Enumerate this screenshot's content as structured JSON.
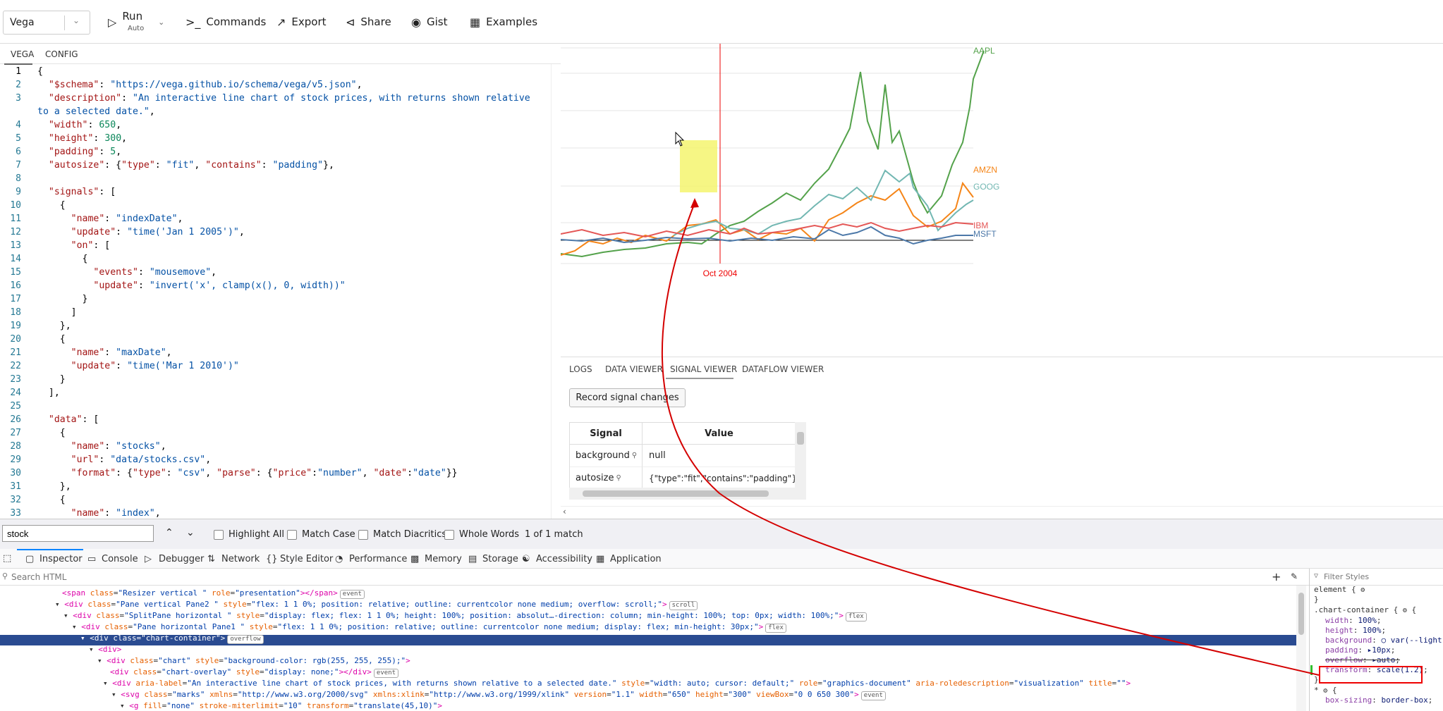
{
  "toolbar": {
    "mode": "Vega",
    "run": "Run",
    "run_sub": "Auto",
    "commands": "Commands",
    "export": "Export",
    "share": "Share",
    "gist": "Gist",
    "examples": "Examples"
  },
  "editor": {
    "tabs": [
      "VEGA",
      "CONFIG"
    ]
  },
  "chart_data": {
    "type": "line",
    "series": [
      {
        "name": "AAPL",
        "color": "#54a24b"
      },
      {
        "name": "AMZN",
        "color": "#f58518"
      },
      {
        "name": "GOOG",
        "color": "#72b7b2"
      },
      {
        "name": "IBM",
        "color": "#e45756"
      },
      {
        "name": "MSFT",
        "color": "#4c78a8"
      }
    ],
    "rule_label": "Oct 2004",
    "grid": true
  },
  "debug": {
    "tabs": [
      "LOGS",
      "DATA VIEWER",
      "SIGNAL VIEWER",
      "DATAFLOW VIEWER"
    ],
    "record_button": "Record signal changes",
    "table": {
      "headers": [
        "Signal",
        "Value"
      ],
      "rows": [
        {
          "signal": "background",
          "value": "null"
        },
        {
          "signal": "autosize",
          "value": "{\"type\":\"fit\",\"contains\":\"padding\"}"
        }
      ]
    }
  },
  "findbar": {
    "query": "stock",
    "highlight_all": "Highlight All",
    "match_case": "Match Case",
    "match_diacritics": "Match Diacritics",
    "whole_words": "Whole Words",
    "status": "1 of 1 match"
  },
  "devtools": {
    "tabs": [
      "Inspector",
      "Console",
      "Debugger",
      "Network",
      "Style Editor",
      "Performance",
      "Memory",
      "Storage",
      "Accessibility",
      "Application"
    ],
    "search_placeholder": "Search HTML",
    "filter_placeholder": "Filter Styles"
  }
}
